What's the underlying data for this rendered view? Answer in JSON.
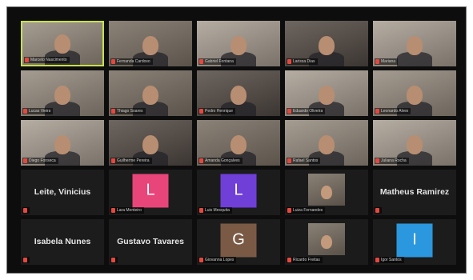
{
  "accent_colors": {
    "active_speaker": "#c8e04a",
    "muted_mic": "#e5483f",
    "background": "#0d0d0d"
  },
  "tiles": [
    {
      "type": "video",
      "tone": 2,
      "speaking": true,
      "label": "Marcelo Nascimento"
    },
    {
      "type": "video",
      "tone": 1,
      "label": "Fernanda Cardoso"
    },
    {
      "type": "video",
      "tone": 4,
      "label": "Gabriel Fontana"
    },
    {
      "type": "video",
      "tone": 3,
      "label": "Larissa Dias"
    },
    {
      "type": "video",
      "tone": 4,
      "label": "Mariana"
    },
    {
      "type": "video",
      "tone": 2,
      "label": "Lucas Vieira"
    },
    {
      "type": "video",
      "tone": 1,
      "label": "Thiago Soares"
    },
    {
      "type": "video",
      "tone": 3,
      "label": "Pedro Henrique"
    },
    {
      "type": "video",
      "tone": 4,
      "label": "Eduardo Oliveira"
    },
    {
      "type": "video",
      "tone": 2,
      "label": "Leonardo Alves"
    },
    {
      "type": "video",
      "tone": 4,
      "label": "Diego Fonseca"
    },
    {
      "type": "video",
      "tone": 3,
      "label": "Guilherme Pereira"
    },
    {
      "type": "video",
      "tone": 1,
      "label": "Amanda Gonçalves"
    },
    {
      "type": "video",
      "tone": 2,
      "label": "Rafael Santos"
    },
    {
      "type": "video",
      "tone": 4,
      "label": "Juliana Rocha"
    },
    {
      "type": "name",
      "name": "Leite, Vinicius",
      "label": ""
    },
    {
      "type": "avatar",
      "letter": "L",
      "avatar_color": "#e8457b",
      "label": "Lara Monteiro"
    },
    {
      "type": "avatar",
      "letter": "L",
      "avatar_color": "#6f3fd8",
      "label": "Luis Mesquita"
    },
    {
      "type": "pic",
      "label": "Luiza Fernandes"
    },
    {
      "type": "name",
      "name": "Matheus Ramirez",
      "label": ""
    },
    {
      "type": "name",
      "name": "Isabela Nunes",
      "label": ""
    },
    {
      "type": "name",
      "name": "Gustavo Tavares",
      "label": ""
    },
    {
      "type": "avatar",
      "letter": "G",
      "avatar_color": "#7b5a45",
      "label": "Giovanna Lopes"
    },
    {
      "type": "pic",
      "label": "Ricardo Freitas"
    },
    {
      "type": "avatar",
      "letter": "I",
      "avatar_color": "#2b97de",
      "label": "Igor Santos"
    }
  ]
}
